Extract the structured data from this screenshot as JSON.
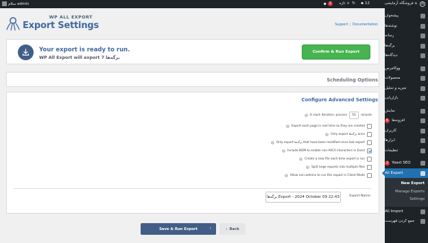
{
  "admin_bar": {
    "site_name": "فروشگاه آزمایشی",
    "comments_count": "12",
    "new_label": "تازه",
    "updates_badge": "2",
    "greeting": "سلام admin",
    "icons": [
      "wordpress-icon",
      "home-icon",
      "updates-icon",
      "comments-icon",
      "plus-icon",
      "user-avatar"
    ]
  },
  "header": {
    "brand_small": "WP ALL EXPORT",
    "title": "Export Settings",
    "support_label": "Support",
    "separator": "|",
    "documentation_label": "Documentation"
  },
  "ready_panel": {
    "title": "Your export is ready to run.",
    "subtitle": "WP All Export will export 7 برگه‌ها",
    "confirm_button": "Confirm & Run Export"
  },
  "scheduling": {
    "title": "Scheduling Options"
  },
  "advanced": {
    "title": "Configure Advanced Settings",
    "iteration_prefix": "In each iteration, process",
    "iteration_value": "50",
    "iteration_suffix": "records",
    "options": [
      {
        "label": "Export each page in real time as they are created",
        "checked": false
      },
      {
        "label": "Only export برگه‌ها once",
        "checked": false
      },
      {
        "label": "Only export برگه‌ها that have been modified since last export",
        "checked": false
      },
      {
        "label": "Include BOM to enable non-ASCII characters in Excel",
        "checked": true
      },
      {
        "label": "Create a new file each time export is run",
        "checked": false
      },
      {
        "label": "Split large exports into multiple files",
        "checked": false
      },
      {
        "label": "Allow non-admins to run this export in Client Mode",
        "checked": false
      }
    ],
    "export_name_label": "Export Name:",
    "export_name_value": "برگه‌ها Export - 2024 October 09 22:43"
  },
  "footer_buttons": {
    "save_run": "Save & Run Export",
    "back": "Back"
  },
  "sidebar": {
    "items": [
      {
        "label": "پیشخوان",
        "icon": "dashboard-icon"
      },
      {
        "label": "نوشته‌ها",
        "icon": "pin-icon"
      },
      {
        "label": "رسانه",
        "icon": "media-icon"
      },
      {
        "label": "برگه‌ها",
        "icon": "pages-icon"
      },
      {
        "label": "دیدگاه‌ها",
        "icon": "comments-icon"
      },
      {
        "label": "ووکامرس",
        "icon": "woocommerce-icon"
      },
      {
        "label": "محصولات",
        "icon": "products-icon"
      },
      {
        "label": "تجزیه و تحلیل",
        "icon": "analytics-icon"
      },
      {
        "label": "بازاریابی",
        "icon": "marketing-icon"
      },
      {
        "label": "نمایش",
        "icon": "appearance-icon"
      },
      {
        "label": "افزونه‌ها",
        "icon": "plugins-icon",
        "badge": "6"
      },
      {
        "label": "کاربران",
        "icon": "users-icon"
      },
      {
        "label": "ابزارها",
        "icon": "tools-icon"
      },
      {
        "label": "تنظیمات",
        "icon": "settings-icon"
      },
      {
        "label": "Yoast SEO",
        "icon": "yoast-icon",
        "badge": "2"
      },
      {
        "label": "All Export",
        "icon": "all-export-icon",
        "active": true
      }
    ],
    "submenu": [
      "New Export",
      "Manage Exports",
      "Settings"
    ],
    "after": [
      {
        "label": "All Import",
        "icon": "all-import-icon"
      },
      {
        "label": "جمع کردن فهرست",
        "icon": "collapse-icon"
      }
    ]
  }
}
